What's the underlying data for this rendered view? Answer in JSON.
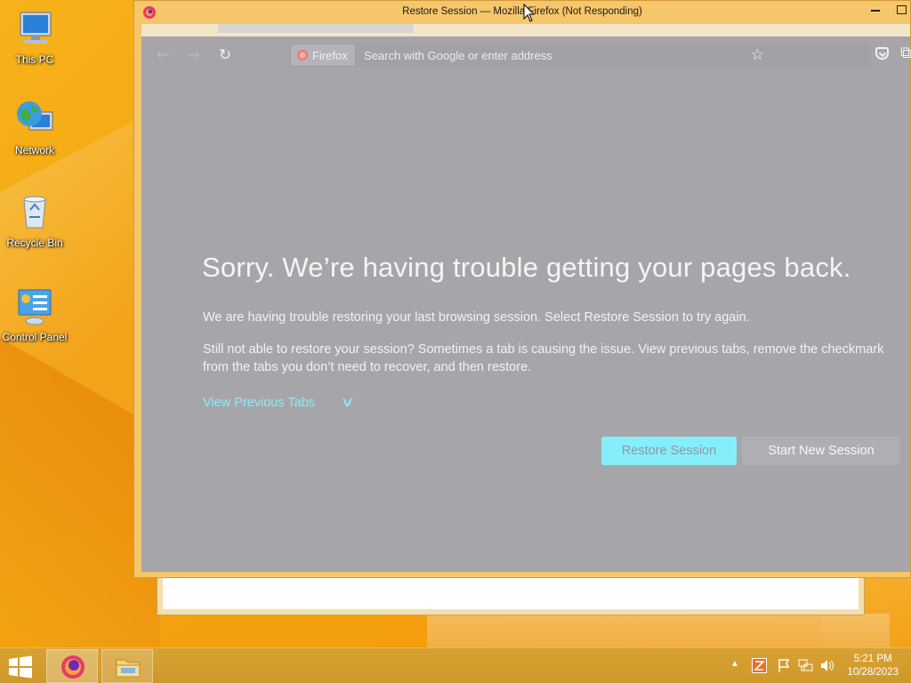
{
  "desktop": {
    "icons": [
      {
        "label": "This PC"
      },
      {
        "label": "Network"
      },
      {
        "label": "Recycle Bin"
      },
      {
        "label": "Control Panel"
      }
    ]
  },
  "window": {
    "title": "Restore Session — Mozilla Firefox (Not Responding)",
    "toolbar": {
      "identity_label": "Firefox",
      "url_placeholder": "Search with Google or enter address"
    },
    "error_page": {
      "title": "Sorry. We’re having trouble getting your pages back.",
      "message1": "We are having trouble restoring your last browsing session. Select Restore Session to try again.",
      "message2": "Still not able to restore your session? Sometimes a tab is causing the issue. View previous tabs, remove the checkmark from the tabs you don’t need to recover, and then restore.",
      "view_previous_tabs": "View Previous Tabs",
      "restore_button": "Restore Session",
      "new_session_button": "Start New Session"
    }
  },
  "taskbar": {
    "clock_time": "5:21 PM",
    "clock_date": "10/28/2023"
  },
  "colors": {
    "accent_link": "#8fe9f4",
    "restore_button_bg": "#86eefa",
    "taskbar": "#d49e2f"
  }
}
